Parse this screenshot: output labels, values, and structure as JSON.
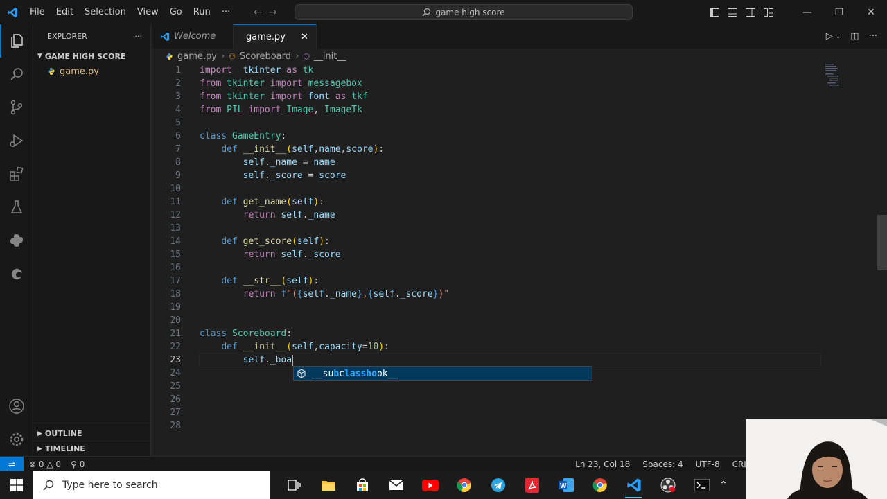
{
  "titlebar": {
    "menu": [
      "File",
      "Edit",
      "Selection",
      "View",
      "Go",
      "Run",
      "···"
    ],
    "search": "game high score"
  },
  "sidebar": {
    "header": "EXPLORER",
    "more": "···",
    "folder": "GAME HIGH SCORE",
    "file": "game.py",
    "outline": "OUTLINE",
    "timeline": "TIMELINE"
  },
  "tabs": [
    {
      "label": "Welcome",
      "active": false
    },
    {
      "label": "game.py",
      "active": true
    }
  ],
  "breadcrumb": [
    "game.py",
    "Scoreboard",
    "__init__"
  ],
  "editor": {
    "line_numbers": [
      "1",
      "2",
      "3",
      "4",
      "5",
      "6",
      "7",
      "8",
      "9",
      "10",
      "11",
      "12",
      "13",
      "14",
      "15",
      "16",
      "17",
      "18",
      "19",
      "20",
      "21",
      "22",
      "23",
      "24",
      "25",
      "26",
      "27",
      "28"
    ],
    "current_line": 23,
    "lines": [
      [
        [
          "kw2",
          "import"
        ],
        [
          "",
          "  "
        ],
        [
          "var",
          "tkinter"
        ],
        [
          "",
          " "
        ],
        [
          "kw2",
          "as"
        ],
        [
          "",
          " "
        ],
        [
          "mod",
          "tk"
        ]
      ],
      [
        [
          "kw2",
          "from"
        ],
        [
          "",
          " "
        ],
        [
          "mod",
          "tkinter"
        ],
        [
          "",
          " "
        ],
        [
          "kw2",
          "import"
        ],
        [
          "",
          " "
        ],
        [
          "mod",
          "messagebox"
        ]
      ],
      [
        [
          "kw2",
          "from"
        ],
        [
          "",
          " "
        ],
        [
          "mod",
          "tkinter"
        ],
        [
          "",
          " "
        ],
        [
          "kw2",
          "import"
        ],
        [
          "",
          " "
        ],
        [
          "var",
          "font"
        ],
        [
          "",
          " "
        ],
        [
          "kw2",
          "as"
        ],
        [
          "",
          " "
        ],
        [
          "mod",
          "tkf"
        ]
      ],
      [
        [
          "kw2",
          "from"
        ],
        [
          "",
          " "
        ],
        [
          "mod",
          "PIL"
        ],
        [
          "",
          " "
        ],
        [
          "kw2",
          "import"
        ],
        [
          "",
          " "
        ],
        [
          "mod",
          "Image"
        ],
        [
          "",
          ", "
        ],
        [
          "mod",
          "ImageTk"
        ]
      ],
      [],
      [
        [
          "kw",
          "class"
        ],
        [
          "",
          " "
        ],
        [
          "mod",
          "GameEntry"
        ],
        [
          "",
          ":"
        ]
      ],
      [
        [
          "",
          "    "
        ],
        [
          "kw",
          "def"
        ],
        [
          "",
          " "
        ],
        [
          "fn",
          "__init__"
        ],
        [
          "punc",
          "("
        ],
        [
          "var",
          "self"
        ],
        [
          "",
          ","
        ],
        [
          "var",
          "name"
        ],
        [
          "",
          ","
        ],
        [
          "var",
          "score"
        ],
        [
          "punc",
          ")"
        ],
        [
          "",
          ":"
        ]
      ],
      [
        [
          "",
          "        "
        ],
        [
          "var",
          "self"
        ],
        [
          "",
          "."
        ],
        [
          "var",
          "_name"
        ],
        [
          "",
          " = "
        ],
        [
          "var",
          "name"
        ]
      ],
      [
        [
          "",
          "        "
        ],
        [
          "var",
          "self"
        ],
        [
          "",
          "."
        ],
        [
          "var",
          "_score"
        ],
        [
          "",
          " = "
        ],
        [
          "var",
          "score"
        ]
      ],
      [],
      [
        [
          "",
          "    "
        ],
        [
          "kw",
          "def"
        ],
        [
          "",
          " "
        ],
        [
          "fn",
          "get_name"
        ],
        [
          "punc",
          "("
        ],
        [
          "var",
          "self"
        ],
        [
          "punc",
          ")"
        ],
        [
          "",
          ":"
        ]
      ],
      [
        [
          "",
          "        "
        ],
        [
          "kw2",
          "return"
        ],
        [
          "",
          " "
        ],
        [
          "var",
          "self"
        ],
        [
          "",
          "."
        ],
        [
          "var",
          "_name"
        ]
      ],
      [],
      [
        [
          "",
          "    "
        ],
        [
          "kw",
          "def"
        ],
        [
          "",
          " "
        ],
        [
          "fn",
          "get_score"
        ],
        [
          "punc",
          "("
        ],
        [
          "var",
          "self"
        ],
        [
          "punc",
          ")"
        ],
        [
          "",
          ":"
        ]
      ],
      [
        [
          "",
          "        "
        ],
        [
          "kw2",
          "return"
        ],
        [
          "",
          " "
        ],
        [
          "var",
          "self"
        ],
        [
          "",
          "."
        ],
        [
          "var",
          "_score"
        ]
      ],
      [],
      [
        [
          "",
          "    "
        ],
        [
          "kw",
          "def"
        ],
        [
          "",
          " "
        ],
        [
          "fn",
          "__str__"
        ],
        [
          "punc",
          "("
        ],
        [
          "var",
          "self"
        ],
        [
          "punc",
          ")"
        ],
        [
          "",
          ":"
        ]
      ],
      [
        [
          "",
          "        "
        ],
        [
          "kw2",
          "return"
        ],
        [
          "",
          " "
        ],
        [
          "kw",
          "f"
        ],
        [
          "str",
          "\"("
        ],
        [
          "kw",
          "{"
        ],
        [
          "var",
          "self"
        ],
        [
          "",
          "."
        ],
        [
          "var",
          "_name"
        ],
        [
          "kw",
          "}"
        ],
        [
          "str",
          ","
        ],
        [
          "kw",
          "{"
        ],
        [
          "var",
          "self"
        ],
        [
          "",
          "."
        ],
        [
          "var",
          "_score"
        ],
        [
          "kw",
          "}"
        ],
        [
          "str",
          ")\""
        ]
      ],
      [],
      [],
      [
        [
          "kw",
          "class"
        ],
        [
          "",
          " "
        ],
        [
          "mod",
          "Scoreboard"
        ],
        [
          "",
          ":"
        ]
      ],
      [
        [
          "",
          "    "
        ],
        [
          "kw",
          "def"
        ],
        [
          "",
          " "
        ],
        [
          "fn",
          "__init__"
        ],
        [
          "punc",
          "("
        ],
        [
          "var",
          "self"
        ],
        [
          "",
          ","
        ],
        [
          "var",
          "capacity"
        ],
        [
          "",
          "="
        ],
        [
          "num",
          "10"
        ],
        [
          "punc",
          ")"
        ],
        [
          "",
          ":"
        ]
      ],
      [
        [
          "",
          "        "
        ],
        [
          "var",
          "self"
        ],
        [
          "",
          "."
        ],
        [
          "var",
          "_boa"
        ]
      ],
      [],
      [],
      [],
      [],
      []
    ],
    "suggestion": {
      "pre": "__su",
      "b": "b",
      "mid1": "c",
      "l": "l",
      "a": "a",
      "s": "ss",
      "h": "h",
      "o": "o",
      "ok": "ok",
      "post": "__",
      "full": "__subclasshook__"
    }
  },
  "statusbar": {
    "errors": "0",
    "warnings": "0",
    "ports": "0",
    "position": "Ln 23, Col 18",
    "spaces": "Spaces: 4",
    "encoding": "UTF-8",
    "eol": "CRL"
  },
  "taskbar": {
    "search_placeholder": "Type here to search"
  }
}
